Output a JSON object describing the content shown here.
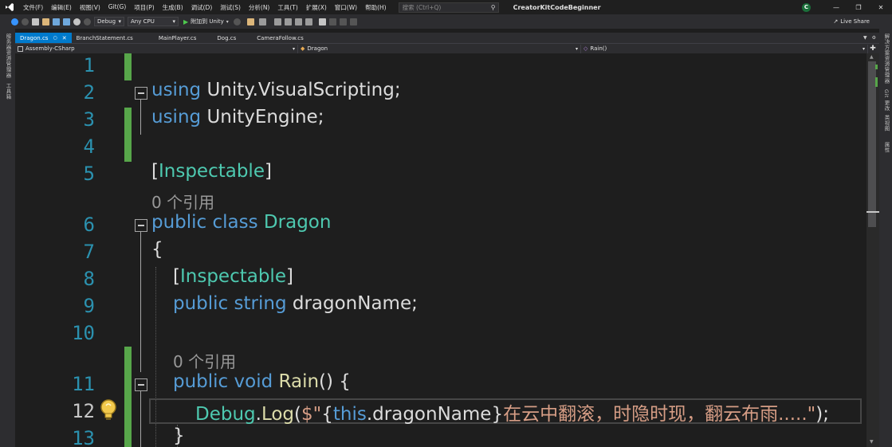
{
  "menu": {
    "items": [
      "文件(F)",
      "编辑(E)",
      "视图(V)",
      "Git(G)",
      "项目(P)",
      "生成(B)",
      "调试(D)",
      "测试(S)",
      "分析(N)",
      "工具(T)",
      "扩展(X)",
      "窗口(W)",
      "帮助(H)"
    ],
    "search_placeholder": "搜索 (Ctrl+Q)",
    "project_title": "CreatorKitCodeBeginner",
    "avatar_letter": "C"
  },
  "toolbar": {
    "config": "Debug",
    "platform": "Any CPU",
    "attach_label": "附加到 Unity",
    "live_share": "Live Share"
  },
  "side_panels": {
    "left": [
      "服务器资源管理器",
      "工具箱"
    ],
    "right": [
      "解决方案资源管理器",
      "Git 更改",
      "类视图",
      "属性"
    ]
  },
  "tabs": [
    {
      "label": "Dragon.cs",
      "active": true
    },
    {
      "label": "BranchStatement.cs",
      "active": false
    },
    {
      "label": "MainPlayer.cs",
      "active": false
    },
    {
      "label": "Dog.cs",
      "active": false
    },
    {
      "label": "CameraFollow.cs",
      "active": false
    }
  ],
  "navbar": {
    "project": "Assembly-CSharp",
    "type": "Dragon",
    "member": "Rain()"
  },
  "editor": {
    "line_numbers": [
      "1",
      "2",
      "3",
      "4",
      "5",
      "6",
      "7",
      "8",
      "9",
      "10",
      "11",
      "12",
      "13"
    ],
    "current_line": "12",
    "ref_count_label": "0 个引用",
    "lines": {
      "l2": {
        "kw": "using",
        "rest": " Unity.VisualScripting;"
      },
      "l3": {
        "kw": "using",
        "rest": " UnityEngine;"
      },
      "l5": {
        "open": "[",
        "attr": "Inspectable",
        "close": "]"
      },
      "l6": {
        "kw1": "public",
        "kw2": " class",
        "name": " Dragon"
      },
      "l7": {
        "text": "{"
      },
      "l8": {
        "open": "[",
        "attr": "Inspectable",
        "close": "]"
      },
      "l9": {
        "kw1": "public",
        "kw2": " string",
        "rest": " dragonName;"
      },
      "l11": {
        "kw1": "public",
        "kw2": " void",
        "fn": " Rain",
        "rest": "() {"
      },
      "l12": {
        "type": "Debug",
        "dot": ".",
        "fn": "Log",
        "paren": "(",
        "str_open": "$\"",
        "brace_open": "{",
        "this_kw": "this",
        "member": ".dragonName",
        "brace_close": "}",
        "str_text": "在云中翻滚，时隐时现，翻云布雨.....\"",
        "end": ");"
      },
      "l13": {
        "text": "}"
      }
    }
  }
}
